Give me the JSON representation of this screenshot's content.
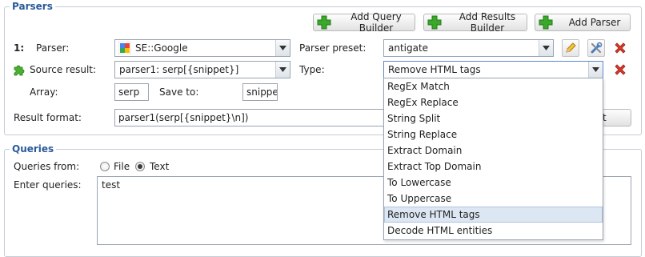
{
  "parsers": {
    "legend": "Parsers",
    "buttons": {
      "add_query_builder": "Add Query Builder",
      "add_results_builder": "Add Results Builder",
      "add_parser": "Add Parser"
    },
    "row_number": "1:",
    "parser_label": "Parser:",
    "parser_value": "SE::Google",
    "preset_label": "Parser preset:",
    "preset_value": "antigate",
    "source_label": "Source result:",
    "source_value": "parser1: serp[{snippet}]",
    "type_label": "Type:",
    "type_value": "Remove HTML tags",
    "array_label": "Array:",
    "array_value": "serp",
    "save_to_label": "Save to:",
    "save_to_value": "snippe",
    "result_format_label": "Result format:",
    "result_format_value": "parser1(serp[{snippet}\\n])",
    "format_button_partial": "mat"
  },
  "type_dropdown": {
    "options": [
      "RegEx Match",
      "RegEx Replace",
      "String Split",
      "String Replace",
      "Extract Domain",
      "Extract Top Domain",
      "To Lowercase",
      "To Uppercase",
      "Remove HTML tags",
      "Decode HTML entities"
    ],
    "selected": "Remove HTML tags"
  },
  "queries": {
    "legend": "Queries",
    "from_label": "Queries from:",
    "opt_file": "File",
    "opt_text": "Text",
    "selected": "Text",
    "enter_label": "Enter queries:",
    "text": "test"
  },
  "colors": {
    "legend_blue": "#2a5a9a",
    "plus_green": "#3aa82a",
    "delete_red": "#d93a2b",
    "selected_option_bg": "#dde7f3"
  }
}
